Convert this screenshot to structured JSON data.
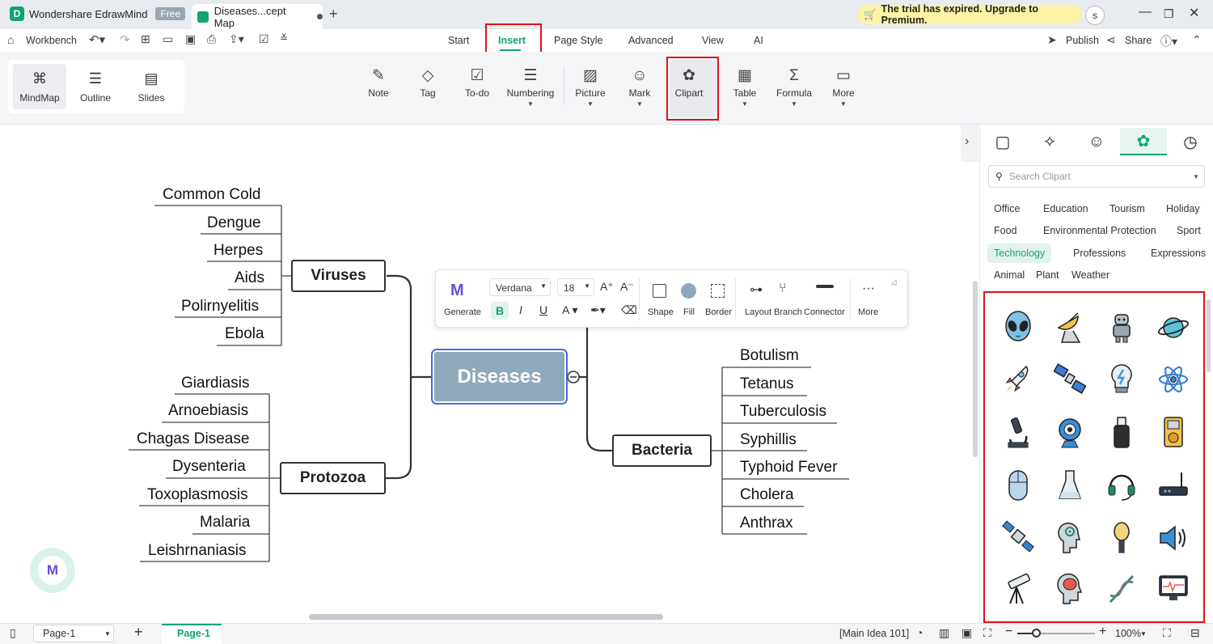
{
  "app": {
    "name": "Wondershare EdrawMind",
    "badge": "Free",
    "doc_tab": "Diseases...cept Map",
    "trial": "The trial has expired. Upgrade to Premium.",
    "user_initial": "s"
  },
  "menubar": {
    "workbench": "Workbench",
    "tabs": [
      "Start",
      "Insert",
      "Page Style",
      "Advanced",
      "View",
      "AI"
    ],
    "publish": "Publish",
    "share": "Share"
  },
  "ribbon": {
    "views": [
      "MindMap",
      "Outline",
      "Slides"
    ],
    "tools": [
      "Note",
      "Tag",
      "To-do",
      "Numbering",
      "Picture",
      "Mark",
      "Clipart",
      "Table",
      "Formula",
      "More"
    ]
  },
  "mindmap": {
    "central": "Diseases",
    "branches": {
      "viruses": {
        "label": "Viruses",
        "children": [
          "Common Cold",
          "Dengue",
          "Herpes",
          "Aids",
          "Polirnyelitis",
          "Ebola"
        ]
      },
      "protozoa": {
        "label": "Protozoa",
        "children": [
          "Giardiasis",
          "Arnoebiasis",
          "Chagas Disease",
          "Dysenteria",
          "Toxoplasmosis",
          "Malaria",
          "Leishrnaniasis"
        ]
      },
      "bacteria": {
        "label": "Bacteria",
        "children": [
          "Botulism",
          "Tetanus",
          "Tuberculosis",
          "Syphillis",
          "Typhoid Fever",
          "Cholera",
          "Anthrax"
        ]
      }
    }
  },
  "floatbar": {
    "generate": "Generate",
    "font": "Verdana",
    "size": "18",
    "labels": [
      "Shape",
      "Fill",
      "Border",
      "Layout",
      "Branch",
      "Connector",
      "More"
    ]
  },
  "clipart_panel": {
    "search_placeholder": "Search Clipart",
    "categories": [
      "Office",
      "Education",
      "Tourism",
      "Holiday",
      "Food",
      "Environmental Protection",
      "Sport",
      "Technology",
      "Professions",
      "Expressions",
      "Animal",
      "Plant",
      "Weather"
    ],
    "selected_category": "Technology",
    "icons": [
      "alien-icon",
      "satellite-dish-icon",
      "robot-icon",
      "planet-icon",
      "rocket-icon",
      "satellite-icon",
      "lightbulb-icon",
      "atom-icon",
      "microscope-icon",
      "webcam-icon",
      "usb-drive-icon",
      "mp3-player-icon",
      "mouse-icon",
      "flask-icon",
      "headset-icon",
      "router-icon",
      "space-satellite-icon",
      "brain-signal-icon",
      "microphone-icon",
      "speaker-icon",
      "telescope-icon",
      "brain-head-icon",
      "dna-icon",
      "monitor-icon"
    ]
  },
  "statusbar": {
    "page_select": "Page-1",
    "page_tab": "Page-1",
    "status": "[Main Idea 101]",
    "zoom": "100%"
  },
  "colors": {
    "accent": "#11a46e",
    "highlight": "#e0101a",
    "central_fill": "#8ea9bc",
    "trial_bg": "#fdf3a6"
  }
}
